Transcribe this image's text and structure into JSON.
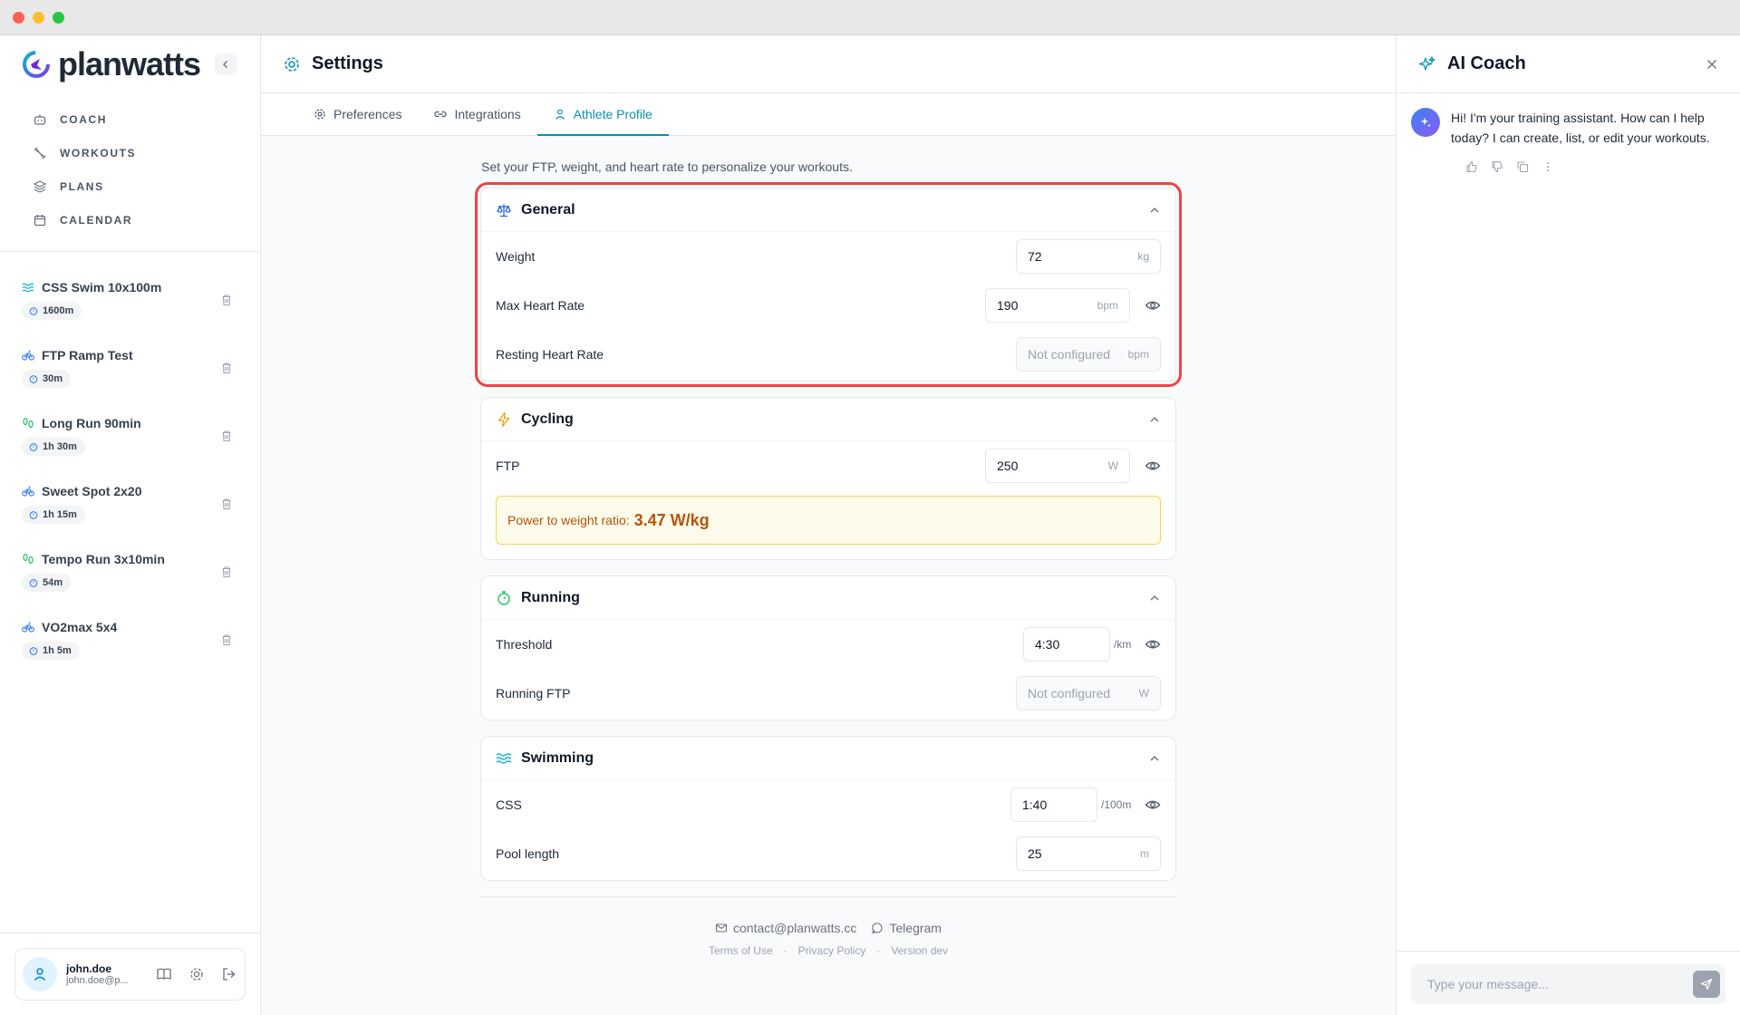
{
  "brand": {
    "name": "planwatts",
    "accent": "#0891b2"
  },
  "nav": [
    {
      "label": "COACH",
      "icon": "robot-icon"
    },
    {
      "label": "WORKOUTS",
      "icon": "dumbbell-icon"
    },
    {
      "label": "PLANS",
      "icon": "layers-icon"
    },
    {
      "label": "CALENDAR",
      "icon": "calendar-icon"
    }
  ],
  "workouts": [
    {
      "title": "CSS Swim 10x100m",
      "badge": "1600m",
      "sport": "swim"
    },
    {
      "title": "FTP Ramp Test",
      "badge": "30m",
      "sport": "bike"
    },
    {
      "title": "Long Run 90min",
      "badge": "1h 30m",
      "sport": "run"
    },
    {
      "title": "Sweet Spot 2x20",
      "badge": "1h 15m",
      "sport": "bike"
    },
    {
      "title": "Tempo Run 3x10min",
      "badge": "54m",
      "sport": "run"
    },
    {
      "title": "VO2max 5x4",
      "badge": "1h 5m",
      "sport": "bike"
    }
  ],
  "user": {
    "name": "john.doe",
    "email": "john.doe@p..."
  },
  "header": {
    "title": "Settings"
  },
  "tabs": [
    {
      "label": "Preferences",
      "active": false
    },
    {
      "label": "Integrations",
      "active": false
    },
    {
      "label": "Athlete Profile",
      "active": true
    }
  ],
  "intro": "Set your FTP, weight, and heart rate to personalize your workouts.",
  "general": {
    "title": "General",
    "weight": {
      "label": "Weight",
      "value": "72",
      "unit": "kg"
    },
    "max_hr": {
      "label": "Max Heart Rate",
      "value": "190",
      "unit": "bpm"
    },
    "resting_hr": {
      "label": "Resting Heart Rate",
      "value": "",
      "placeholder": "Not configured",
      "unit": "bpm"
    }
  },
  "cycling": {
    "title": "Cycling",
    "ftp": {
      "label": "FTP",
      "value": "250",
      "unit": "W"
    },
    "ratio_label": "Power to weight ratio:",
    "ratio_value": "3.47 W/kg"
  },
  "running": {
    "title": "Running",
    "threshold": {
      "label": "Threshold",
      "value": "4:30",
      "unit": "/km"
    },
    "running_ftp": {
      "label": "Running FTP",
      "value": "",
      "placeholder": "Not configured",
      "unit": "W"
    }
  },
  "swimming": {
    "title": "Swimming",
    "css": {
      "label": "CSS",
      "value": "1:40",
      "unit": "/100m"
    },
    "pool": {
      "label": "Pool length",
      "value": "25",
      "unit": "m"
    }
  },
  "footer": {
    "email": "contact@planwatts.cc",
    "telegram": "Telegram",
    "terms": "Terms of Use",
    "privacy": "Privacy Policy",
    "version": "Version dev",
    "sep": "·"
  },
  "coach": {
    "title": "AI Coach",
    "message": "Hi! I'm your training assistant. How can I help today? I can create, list, or edit your workouts.",
    "input_placeholder": "Type your message..."
  }
}
